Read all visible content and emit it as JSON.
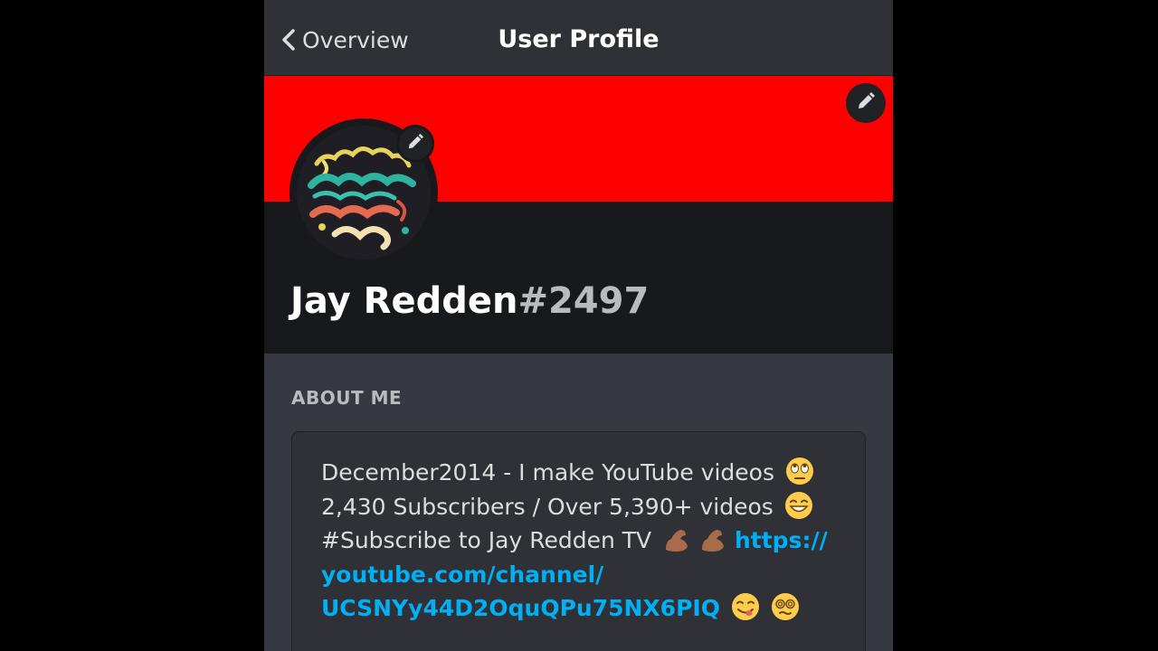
{
  "header": {
    "back_label": "Overview",
    "title": "User Profile"
  },
  "profile": {
    "banner_color": "#ff0000",
    "name": "Jay Redden",
    "discriminator": "#2497",
    "avatar_icon": "lettering-avatar"
  },
  "about": {
    "label": "ABOUT ME",
    "line1": "December2014 - I make YouTube videos",
    "line2": "2,430 Subscribers / Over 5,390+ videos",
    "line3": "#Subscribe to Jay Redden TV",
    "link_part1": "https://",
    "link_part2": "youtube.com/channel/",
    "link_part3": "UCSNYy44D2OquQPu75NX6PIQ"
  },
  "colors": {
    "background": "#36393f",
    "header_dark": "#18191c",
    "link": "#00aff4"
  }
}
